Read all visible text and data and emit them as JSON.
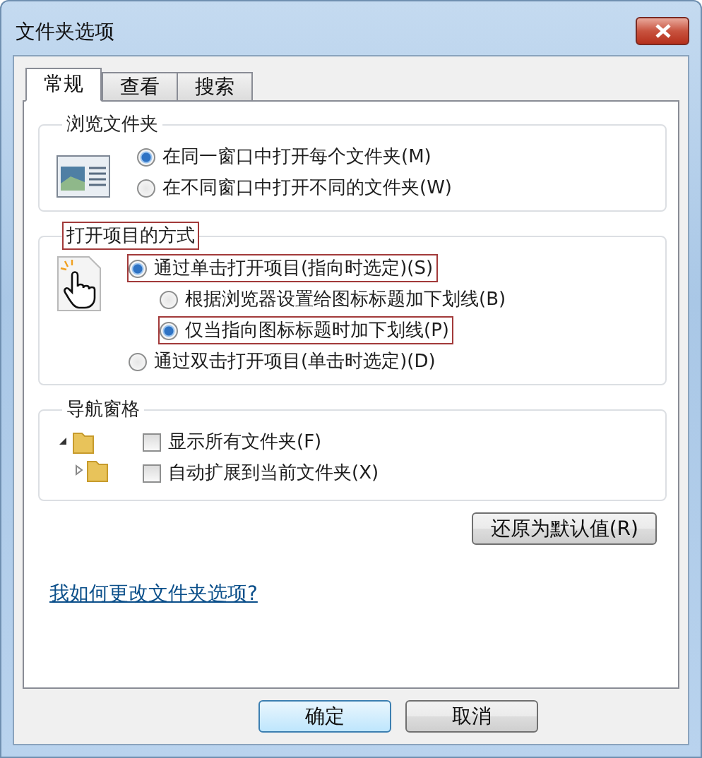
{
  "window": {
    "title": "文件夹选项"
  },
  "tabs": [
    {
      "label": "常规",
      "selected": true
    },
    {
      "label": "查看",
      "selected": false
    },
    {
      "label": "搜索",
      "selected": false
    }
  ],
  "groups": [
    {
      "title": "浏览文件夹",
      "annotated": false,
      "options": [
        {
          "kind": "radio",
          "label": "在同一窗口中打开每个文件夹(M)",
          "selected": true,
          "annotated": false
        },
        {
          "kind": "radio",
          "label": "在不同窗口中打开不同的文件夹(W)",
          "selected": false,
          "annotated": false
        }
      ]
    },
    {
      "title": "打开项目的方式",
      "annotated": true,
      "options": [
        {
          "kind": "radio",
          "label": "通过单击打开项目(指向时选定)(S)",
          "selected": true,
          "annotated": true,
          "children": [
            {
              "kind": "radio",
              "label": "根据浏览器设置给图标标题加下划线(B)",
              "selected": false,
              "annotated": false
            },
            {
              "kind": "radio",
              "label": "仅当指向图标标题时加下划线(P)",
              "selected": true,
              "annotated": true
            }
          ]
        },
        {
          "kind": "radio",
          "label": "通过双击打开项目(单击时选定)(D)",
          "selected": false,
          "annotated": false
        }
      ]
    },
    {
      "title": "导航窗格",
      "annotated": false,
      "options": [
        {
          "kind": "checkbox",
          "label": "显示所有文件夹(F)",
          "checked": false,
          "annotated": false
        },
        {
          "kind": "checkbox",
          "label": "自动扩展到当前文件夹(X)",
          "checked": false,
          "annotated": false
        }
      ]
    }
  ],
  "restore_button": "还原为默认值(R)",
  "help_link": "我如何更改文件夹选项?",
  "buttons": [
    {
      "label": "确定",
      "default": true
    },
    {
      "label": "取消",
      "default": false
    }
  ]
}
